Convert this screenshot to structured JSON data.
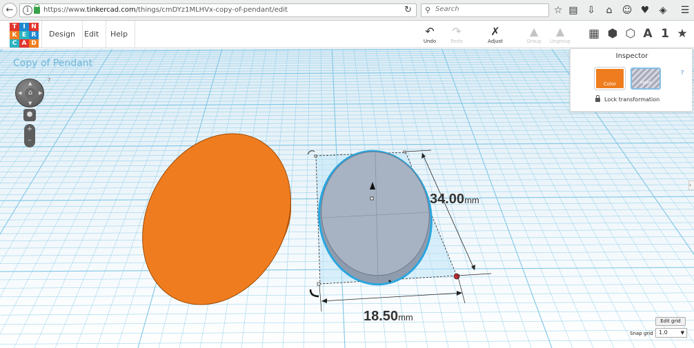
{
  "browser": {
    "url_prefix": "https://www.",
    "url_domain": "tinkercad.com",
    "url_path": "/things/cmDYz1MLHVx-copy-of-pendant/edit",
    "search_placeholder": "Search"
  },
  "app": {
    "logo_letters": [
      "T",
      "I",
      "N",
      "K",
      "E",
      "R",
      "C",
      "A",
      "D"
    ],
    "menu": [
      "Design",
      "Edit",
      "Help"
    ],
    "toolbar": {
      "undo": "Undo",
      "redo": "Redo",
      "adjust": "Adjust",
      "group": "Group",
      "ungroup": "Ungroup"
    },
    "view_text_icon": "A",
    "view_number_icon": "1"
  },
  "workplane": {
    "design_title": "Copy of Pendant",
    "help": "?",
    "dimension_height_value": "34.00",
    "dimension_width_value": "18.50",
    "dimension_unit": "mm"
  },
  "inspector": {
    "title": "Inspector",
    "color_label": "Color",
    "hole_label": "Hole",
    "help": "?",
    "lock_label": "Lock transformation"
  },
  "grid": {
    "edit_grid": "Edit grid",
    "snap_label": "Snap grid",
    "snap_value": "1.0"
  },
  "colors": {
    "shape_orange": "#ef7d1f",
    "hole_gray": "#a8b3c1",
    "grid_blue": "#7fc6e6",
    "selection_blue": "#29a6de"
  }
}
